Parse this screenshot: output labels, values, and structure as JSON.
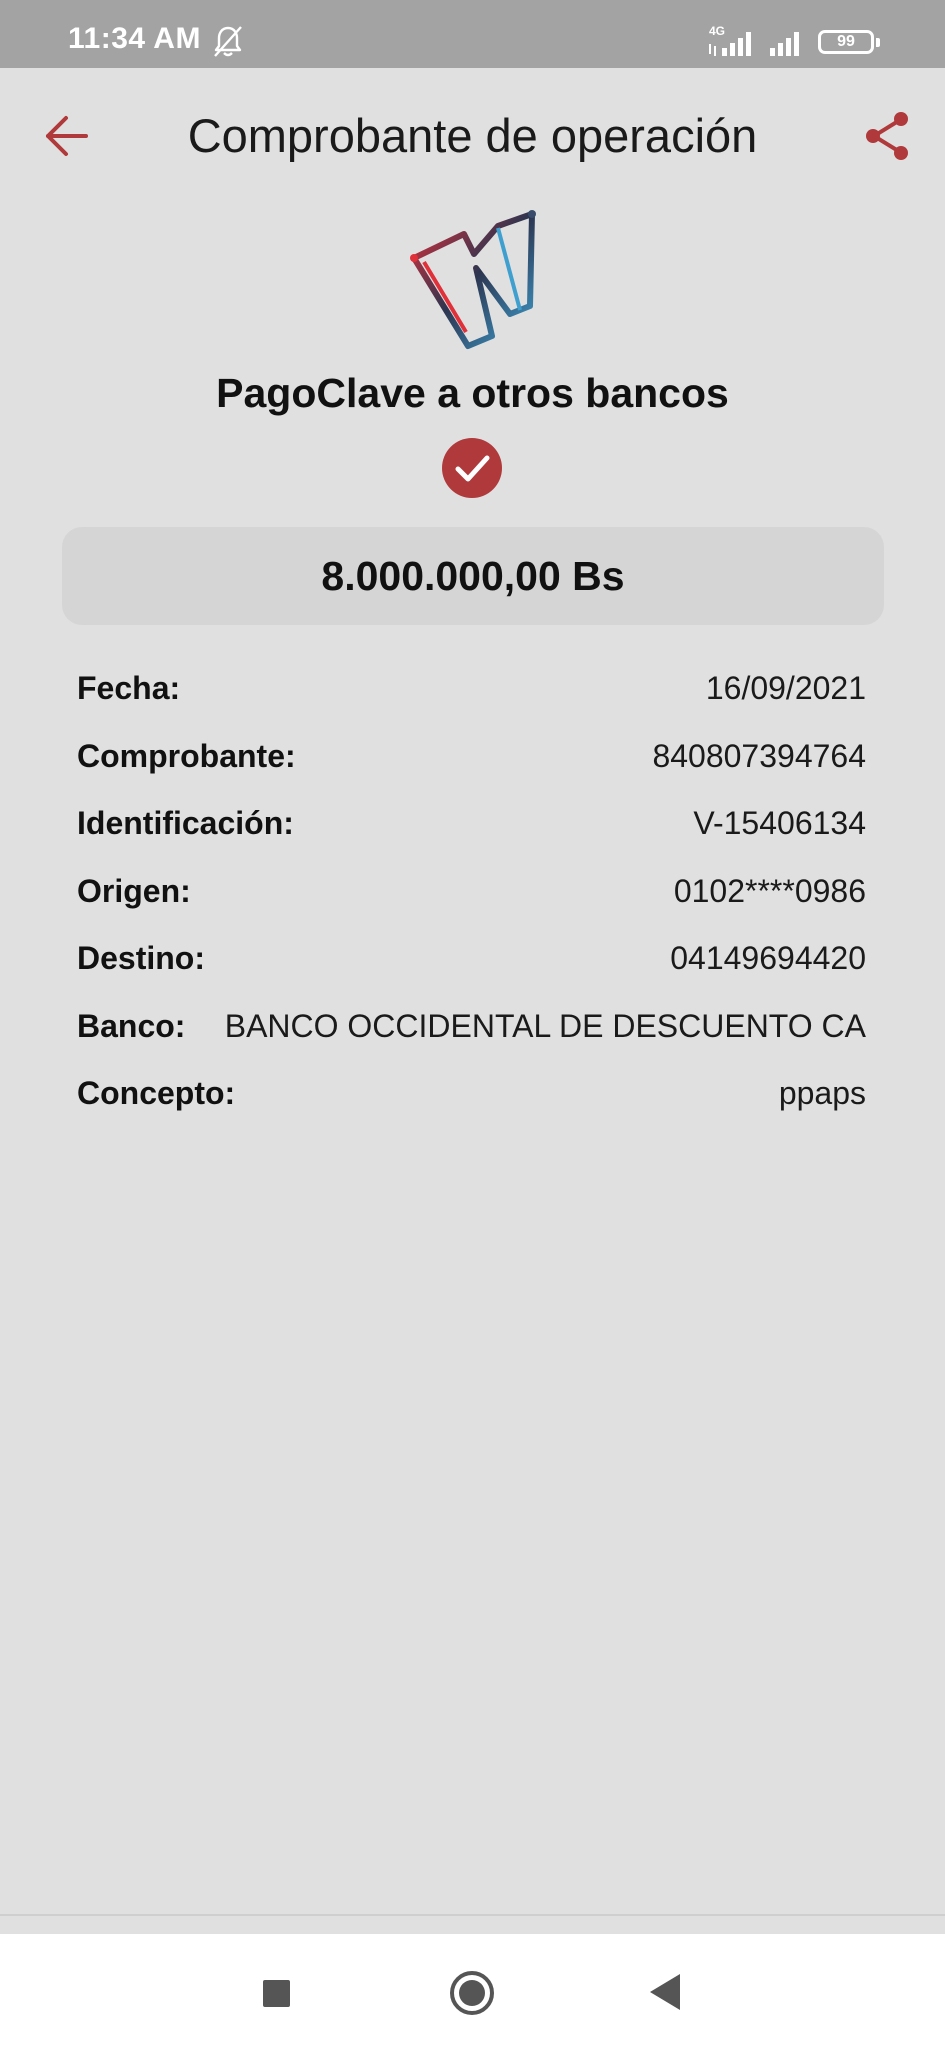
{
  "status_bar": {
    "time": "11:34 AM",
    "network_label": "4G",
    "battery": "99",
    "icons": [
      "bell-off-icon",
      "signal-icon",
      "signal-icon",
      "battery-icon"
    ]
  },
  "app_bar": {
    "title": "Comprobante de operación",
    "back_icon": "arrow-left-icon",
    "share_icon": "share-icon",
    "accent_color": "#b0393b"
  },
  "receipt": {
    "operation_title": "PagoClave a otros bancos",
    "status_icon": "check-circle-icon",
    "amount": "8.000.000,00 Bs",
    "details": [
      {
        "label": "Fecha:",
        "value": "16/09/2021"
      },
      {
        "label": "Comprobante:",
        "value": "840807394764"
      },
      {
        "label": "Identificación:",
        "value": "V-15406134"
      },
      {
        "label": "Origen:",
        "value": "0102****0986"
      },
      {
        "label": "Destino:",
        "value": "04149694420"
      },
      {
        "label": "Banco:",
        "value": "BANCO OCCIDENTAL DE DESCUENTO CA"
      },
      {
        "label": "Concepto:",
        "value": "ppaps"
      }
    ]
  },
  "nav_bar": {
    "icons": [
      "recents-square-icon",
      "home-circle-icon",
      "back-triangle-icon"
    ]
  }
}
